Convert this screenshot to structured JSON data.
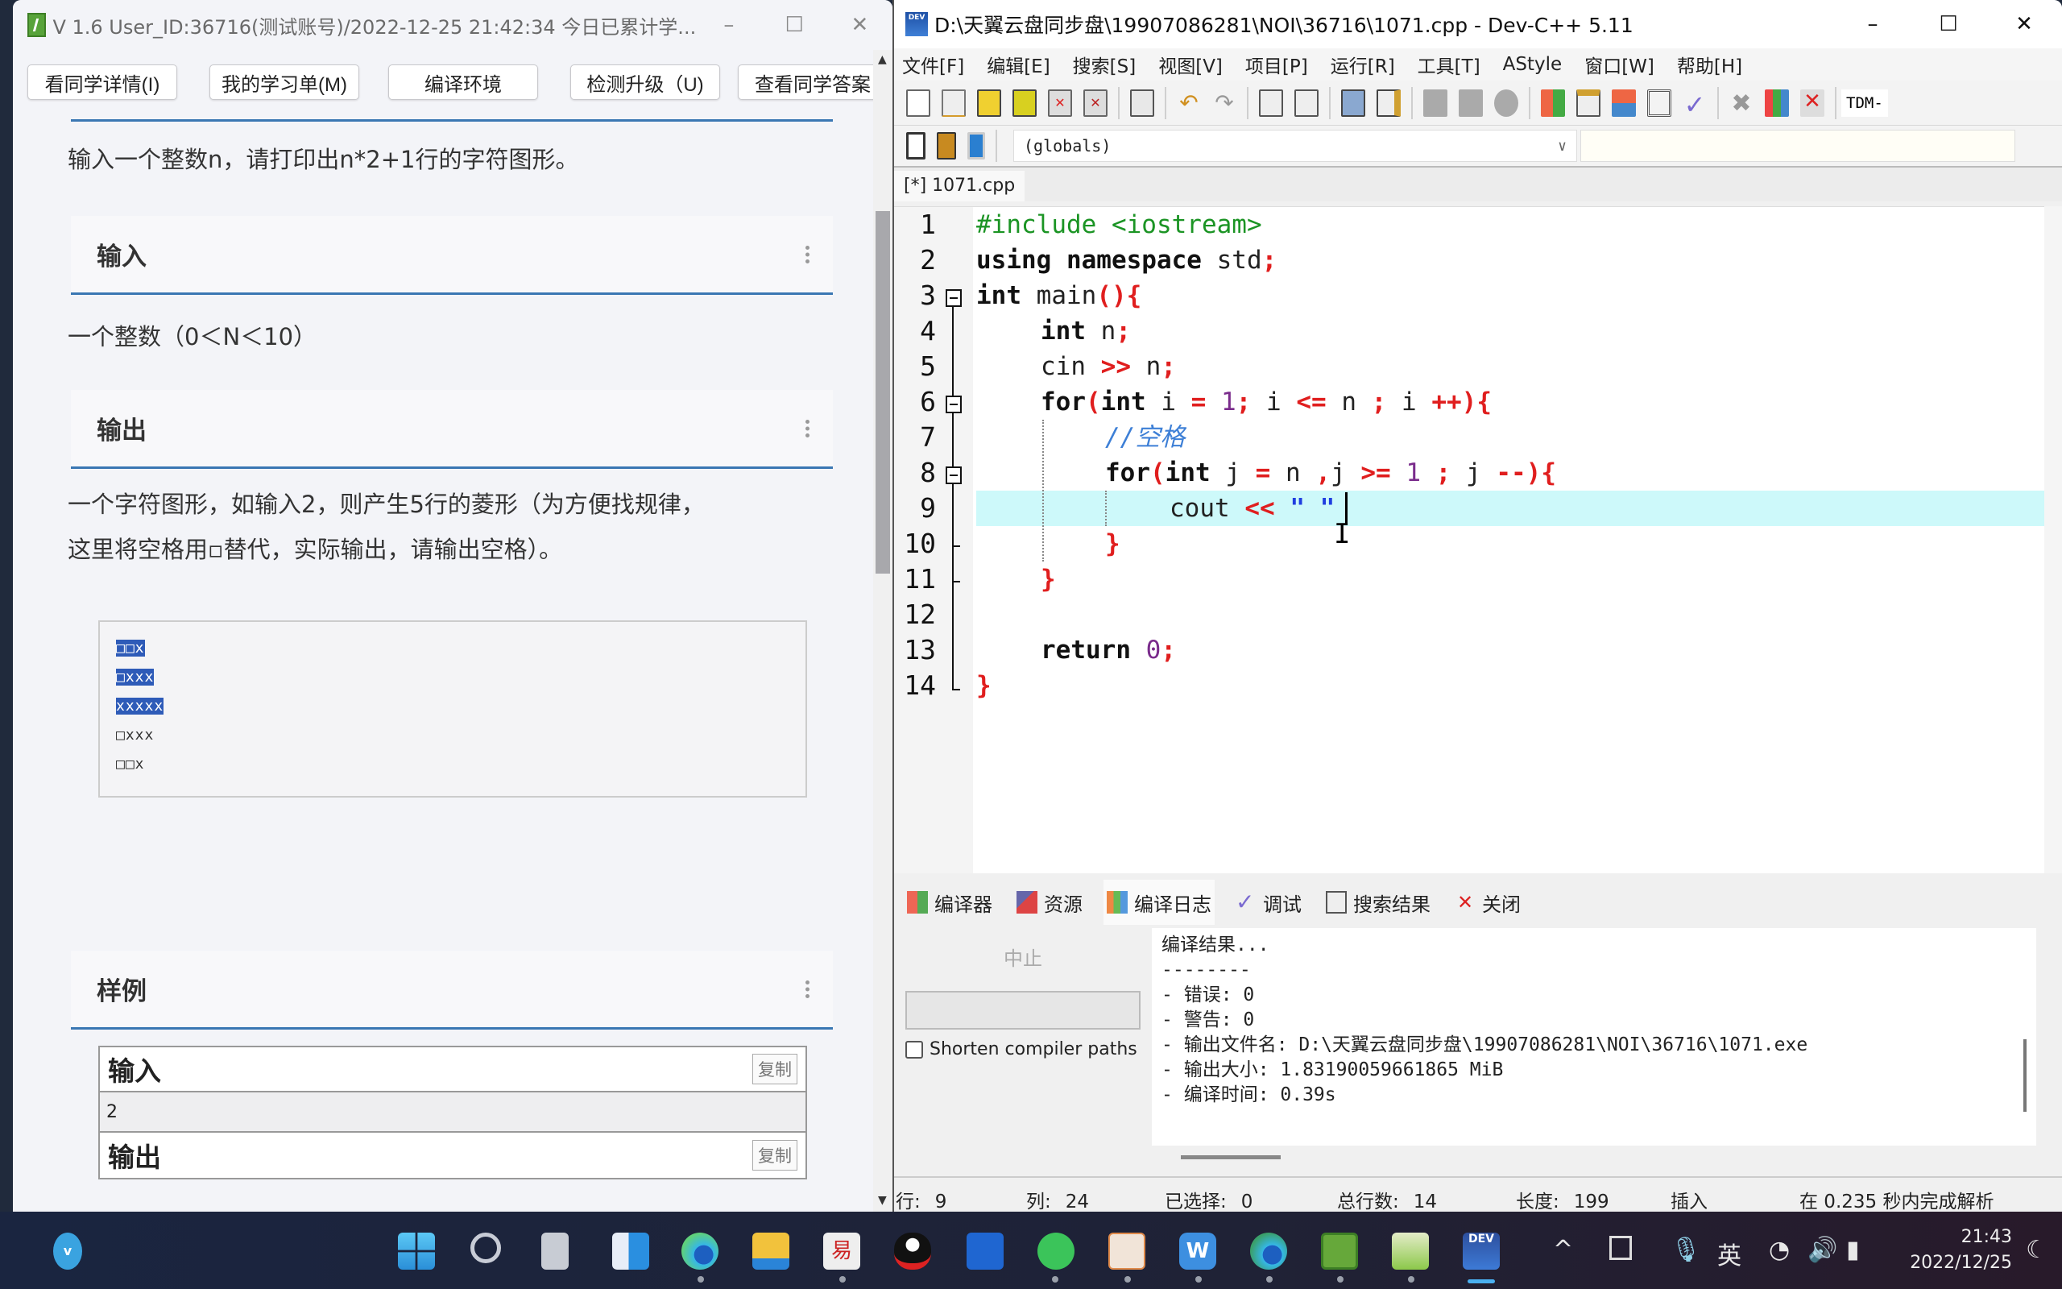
{
  "left_window": {
    "title": "V 1.6 User_ID:36716(测试账号)/2022-12-25 21:42:34 今日已累计学...",
    "controls": {
      "minimize": "–",
      "maximize": "☐",
      "close": "✕"
    },
    "toolbar": [
      {
        "label": "看同学详情(I)"
      },
      {
        "label": "我的学习单(M)"
      },
      {
        "label": "编译环境"
      },
      {
        "label": "检测升级（U)"
      },
      {
        "label": "查看同学答案"
      }
    ],
    "problem": {
      "description": "输入一个整数n，请打印出n*2+1行的字符图形。",
      "input_header": "输入",
      "input_text": "一个整数（0＜N＜10）",
      "output_header": "输出",
      "output_text_1": "一个字符图形，如输入2，则产生5行的菱形（为方便找规律，",
      "output_text_2": "这里将空格用▫替代，实际输出，请输出空格）。",
      "example_lines": [
        "□□x",
        "□xxx",
        "xxxxx",
        "□xxx",
        "□□x"
      ],
      "example_selected_lines": 3,
      "sample_header": "样例",
      "sample_input_label": "输入",
      "sample_input_value": "2",
      "sample_output_label": "输出",
      "copy_label": "复制"
    }
  },
  "devcpp": {
    "title": "D:\\天翼云盘同步盘\\19907086281\\NOI\\36716\\1071.cpp - Dev-C++ 5.11",
    "controls": {
      "minimize": "–",
      "maximize": "☐",
      "close": "✕"
    },
    "menu": [
      "文件[F]",
      "编辑[E]",
      "搜索[S]",
      "视图[V]",
      "项目[P]",
      "运行[R]",
      "工具[T]",
      "AStyle",
      "窗口[W]",
      "帮助[H]"
    ],
    "toolbar_right_label": "TDM-",
    "scope_select": "(globals)",
    "file_tab": "[*] 1071.cpp",
    "line_numbers": [
      "1",
      "2",
      "3",
      "4",
      "5",
      "6",
      "7",
      "8",
      "9",
      "10",
      "11",
      "12",
      "13",
      "14"
    ],
    "code": {
      "l1_pp": "#include <iostream>",
      "l2_a": "using namespace",
      "l2_b": " std",
      "l2_c": ";",
      "l3_a": "int",
      "l3_b": " main",
      "l3_c": "(){",
      "l4_a": "int",
      "l4_b": " n",
      "l4_c": ";",
      "l5_a": "cin ",
      "l5_b": ">>",
      "l5_c": " n",
      "l5_d": ";",
      "l6_for": "for",
      "l6_p": "(",
      "l6_int": "int",
      "l6_i": " i ",
      "l6_eq": "=",
      "l6_1": " 1",
      "l6_sc": ";",
      "l6_i2": " i ",
      "l6_le": "<=",
      "l6_n": " n ",
      "l6_sc2": ";",
      "l6_i3": " i ",
      "l6_pp": "++){",
      "l7_cm": "//空格",
      "l8_for": "for",
      "l8_p": "(",
      "l8_int": "int",
      "l8_j": " j ",
      "l8_eq": "=",
      "l8_n": " n ",
      "l8_c": ",",
      "l8_j2": "j ",
      "l8_ge": ">=",
      "l8_1": " 1 ",
      "l8_sc": ";",
      "l8_j3": " j ",
      "l8_mm": "--){",
      "l9_a": "cout ",
      "l9_b": "<<",
      "l9_c": " \" \"",
      "l10": "}",
      "l11": "}",
      "l13_a": "return",
      "l13_b": " 0",
      "l13_c": ";",
      "l14": "}"
    },
    "bottom_tabs": [
      {
        "label": "编译器"
      },
      {
        "label": "资源"
      },
      {
        "label": "编译日志",
        "active": true
      },
      {
        "label": "调试"
      },
      {
        "label": "搜索结果"
      },
      {
        "label": "关闭"
      }
    ],
    "abort_label": "中止",
    "shorten_paths_label": "Shorten compiler paths",
    "shorten_paths_checked": false,
    "log": [
      "编译结果...",
      "--------",
      "- 错误: 0",
      "- 警告: 0",
      "- 输出文件名: D:\\天翼云盘同步盘\\19907086281\\NOI\\36716\\1071.exe",
      "- 输出大小: 1.83190059661865 MiB",
      "- 编译时间: 0.39s"
    ],
    "status": {
      "row_label": "行:",
      "row": "9",
      "col_label": "列:",
      "col": "24",
      "sel_label": "已选择:",
      "sel": "0",
      "lines_label": "总行数:",
      "lines": "14",
      "len_label": "长度:",
      "len": "199",
      "mode": "插入",
      "parse": "在 0.235 秒内完成解析"
    }
  },
  "taskbar": {
    "apps": [
      "start",
      "search",
      "task-view",
      "widgets",
      "edge",
      "file-explorer",
      "yi-app",
      "qq",
      "whiteboard",
      "wechat",
      "slides",
      "wps-writer",
      "edge-beta",
      "runner-app",
      "notepad-app",
      "dev-cpp"
    ],
    "tray": {
      "chevron": "^",
      "ime": "英"
    },
    "time": "21:43",
    "date": "2022/12/25"
  },
  "colors": {
    "accent_blue": "#3a77b3",
    "selection_blue": "#2e5bb8",
    "active_line": "#cdf9fa",
    "keyword": "#111111",
    "operator": "#e01e1e",
    "preprocessor": "#1b9424",
    "number": "#7a2c8c",
    "string": "#1f3ee0",
    "comment": "#3d7fd6"
  }
}
